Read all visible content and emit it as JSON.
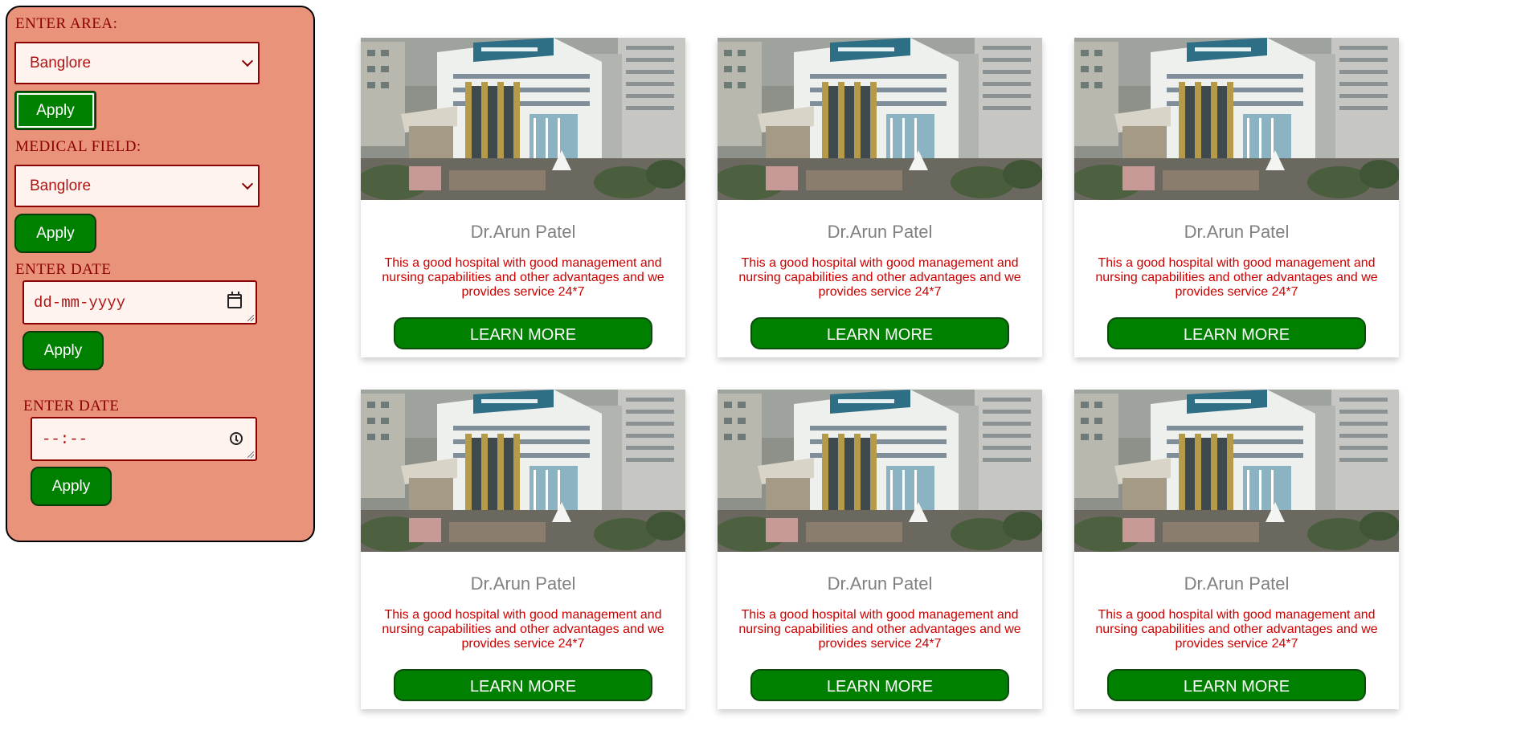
{
  "filters": {
    "area_label": "ENTER AREA:",
    "area_select": "Banglore",
    "area_apply": "Apply",
    "field_label": "MEDICAL FIELD:",
    "field_select": "Banglore",
    "field_apply": "Apply",
    "date_label": "ENTER DATE",
    "date_placeholder": "dd-mm-yyyy",
    "date_apply": "Apply",
    "time_label": "ENTER DATE",
    "time_placeholder": "--:--",
    "time_apply": "Apply"
  },
  "cards": [
    {
      "name": "Dr.Arun Patel",
      "description": "This a good hospital with good management and nursing capabilities and other advantages and we provides service 24*7",
      "button": "LEARN MORE"
    },
    {
      "name": "Dr.Arun Patel",
      "description": "This a good hospital with good management and nursing capabilities and other advantages and we provides service 24*7",
      "button": "LEARN MORE"
    },
    {
      "name": "Dr.Arun Patel",
      "description": "This a good hospital with good management and nursing capabilities and other advantages and we provides service 24*7",
      "button": "LEARN MORE"
    },
    {
      "name": "Dr.Arun Patel",
      "description": "This a good hospital with good management and nursing capabilities and other advantages and we provides service 24*7",
      "button": "LEARN MORE"
    },
    {
      "name": "Dr.Arun Patel",
      "description": "This a good hospital with good management and nursing capabilities and other advantages and we provides service 24*7",
      "button": "LEARN MORE"
    },
    {
      "name": "Dr.Arun Patel",
      "description": "This a good hospital with good management and nursing capabilities and other advantages and we provides service 24*7",
      "button": "LEARN MORE"
    }
  ],
  "colors": {
    "sidebar_bg": "#e9947a",
    "accent_green": "#008000",
    "label_red": "#8b0000",
    "desc_red": "#cc0000"
  }
}
